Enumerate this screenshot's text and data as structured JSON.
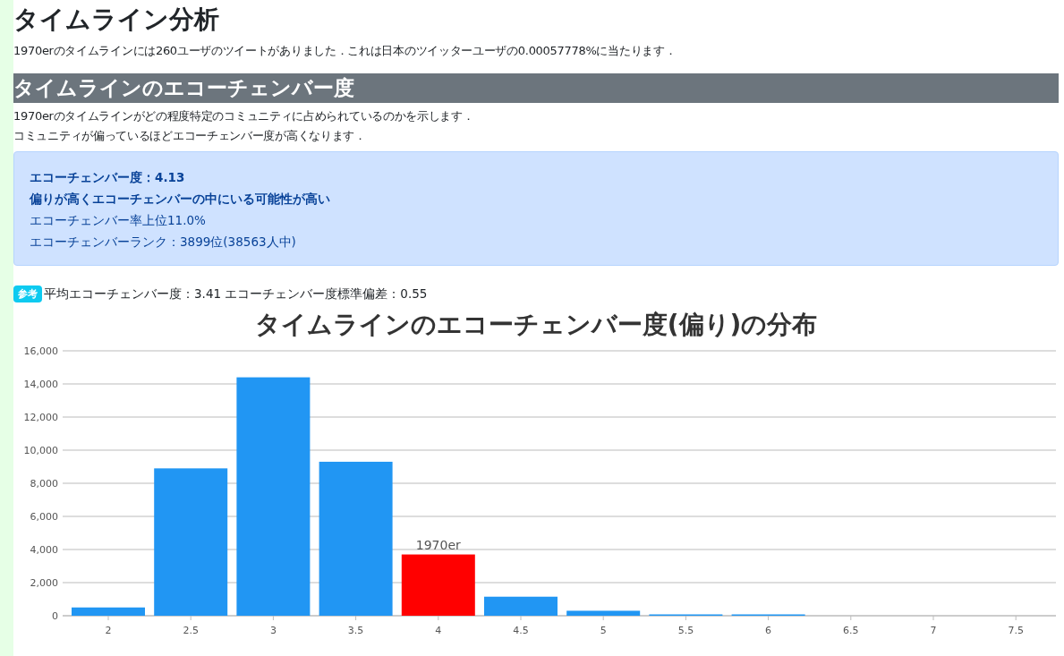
{
  "title": "タイムライン分析",
  "summary": "1970erのタイムラインには260ユーザのツイートがありました．これは日本のツイッターユーザの0.00057778%に当たります．",
  "section": {
    "heading": "タイムラインのエコーチェンバー度",
    "description": [
      "1970erのタイムラインがどの程度特定のコミュニティに占められているのかを示します．",
      "コミュニティが偏っているほどエコーチェンバー度が高くなります．"
    ]
  },
  "result_box": {
    "lines": [
      {
        "text": "エコーチェンバー度：4.13",
        "bold": true
      },
      {
        "text": "偏りが高くエコーチェンバーの中にいる可能性が高い",
        "bold": true
      },
      {
        "text": "エコーチェンバー率上位11.0%",
        "bold": false
      },
      {
        "text": "エコーチェンバーランク：3899位(38563人中)",
        "bold": false
      }
    ]
  },
  "reference": {
    "badge": "参考",
    "text": "平均エコーチェンバー度：3.41 エコーチェンバー度標準偏差：0.55"
  },
  "chart_data": {
    "type": "bar",
    "title": "タイムラインのエコーチェンバー度(偏り)の分布",
    "categories": [
      "2",
      "2.5",
      "3",
      "3.5",
      "4",
      "4.5",
      "5",
      "5.5",
      "6",
      "6.5",
      "7",
      "7.5"
    ],
    "series": [
      {
        "color": "#2196f3",
        "values": [
          500,
          8900,
          14400,
          9300,
          null,
          1150,
          300,
          60,
          20,
          0,
          0,
          0
        ]
      },
      {
        "name": "1970er",
        "color": "#ff0000",
        "values": [
          null,
          null,
          null,
          null,
          3700,
          null,
          null,
          null,
          null,
          null,
          null,
          null
        ]
      }
    ],
    "grid": true,
    "ylim": [
      0,
      16000
    ],
    "yticks": [
      {
        "value": 0,
        "label": "0"
      },
      {
        "value": 2000,
        "label": "2,000"
      },
      {
        "value": 4000,
        "label": "4,000"
      },
      {
        "value": 6000,
        "label": "6,000"
      },
      {
        "value": 8000,
        "label": "8,000"
      },
      {
        "value": 10000,
        "label": "10,000"
      },
      {
        "value": 12000,
        "label": "12,000"
      },
      {
        "value": 14000,
        "label": "14,000"
      },
      {
        "value": 16000,
        "label": "16,000"
      }
    ]
  }
}
